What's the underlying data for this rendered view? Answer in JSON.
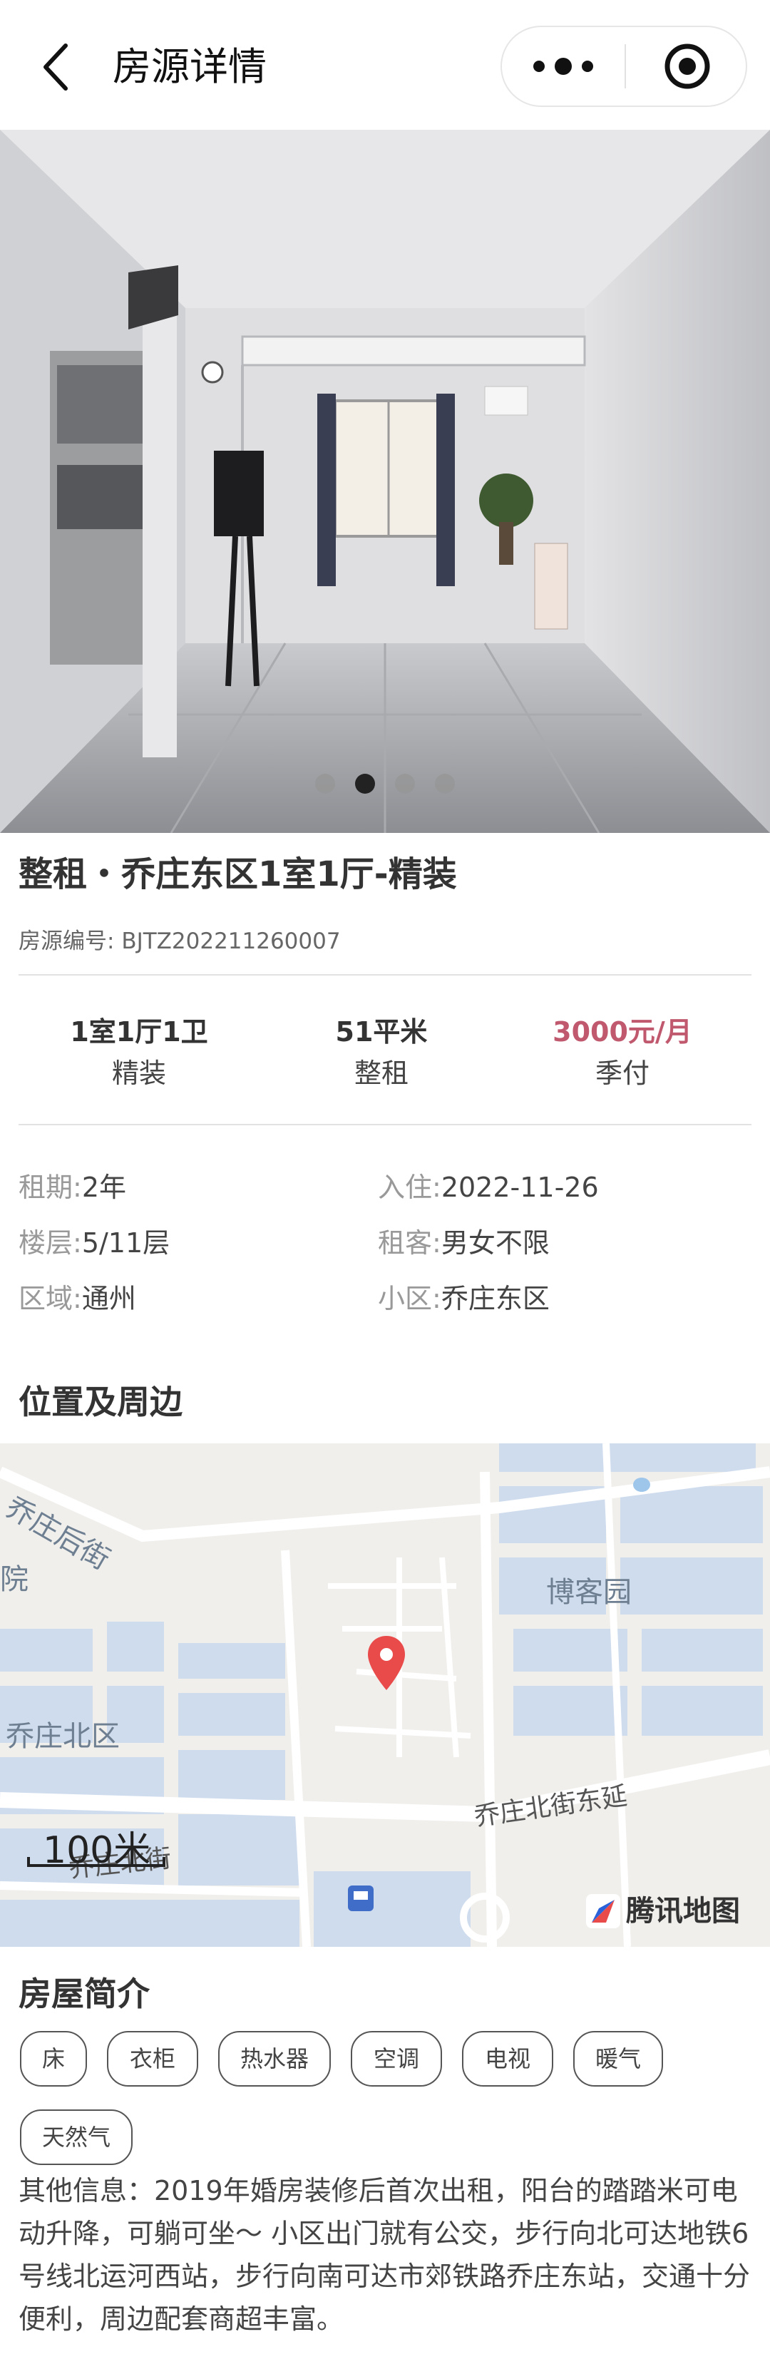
{
  "header": {
    "title": "房源详情",
    "back_icon": "chevron-left-icon",
    "more_icon": "more-dots-icon",
    "target_icon": "target-icon"
  },
  "gallery": {
    "image": "living-room-photo",
    "slides": 4,
    "active_index": 1
  },
  "house": {
    "title": "整租・乔庄东区1室1厅-精装",
    "code_label": "房源编号:",
    "code": "BJTZ202211260007"
  },
  "stats": [
    {
      "value": "1室1厅1卫",
      "label": "精装"
    },
    {
      "value": "51平米",
      "label": "整租"
    },
    {
      "value": "3000元/月",
      "label": "季付"
    }
  ],
  "details": {
    "lease_key": "租期:",
    "lease_val": "2年",
    "move_key": "入住:",
    "move_val": "2022-11-26",
    "floor_key": "楼层:",
    "floor_val": "5/11层",
    "tenant_key": "租客:",
    "tenant_val": "男女不限",
    "area_key": "区域:",
    "area_val": "通州",
    "community_key": "小区:",
    "community_val": "乔庄东区"
  },
  "location": {
    "section_title": "位置及周边",
    "map": {
      "labels": {
        "street1": "乔庄后街",
        "district1": "博客园",
        "district2": "乔庄北区",
        "street2": "乔庄北街东延",
        "street3": "乔庄北街",
        "edge": "院"
      },
      "scale": "100米",
      "brand": "腾讯地图",
      "pin_icon": "map-pin-icon"
    }
  },
  "intro": {
    "section_title": "房屋简介",
    "tags": [
      "床",
      "衣柜",
      "热水器",
      "空调",
      "电视",
      "暖气",
      "天然气"
    ],
    "other_info": "其他信息：2019年婚房装修后首次出租，阳台的踏踏米可电动升降，可躺可坐～ 小区出门就有公交，步行向北可达地铁6号线北运河西站，步行向南可达市郊铁路乔庄东站，交通十分便利，周边配套商超丰富。"
  },
  "colors": {
    "price": "#c0586e",
    "map_block": "#cfdcee",
    "pin": "#e94b4b"
  }
}
